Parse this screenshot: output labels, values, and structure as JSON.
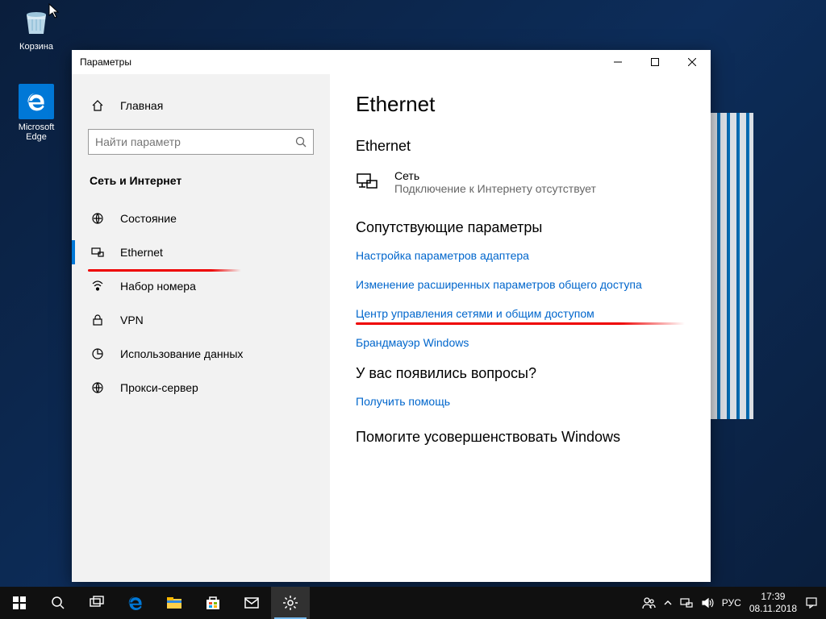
{
  "desktop": {
    "icons": {
      "recycle": "Корзина",
      "edge": "Microsoft Edge"
    }
  },
  "window": {
    "title": "Параметры"
  },
  "sidebar": {
    "home": "Главная",
    "search_placeholder": "Найти параметр",
    "section": "Сеть и Интернет",
    "items": [
      {
        "label": "Состояние"
      },
      {
        "label": "Ethernet"
      },
      {
        "label": "Набор номера"
      },
      {
        "label": "VPN"
      },
      {
        "label": "Использование данных"
      },
      {
        "label": "Прокси-сервер"
      }
    ]
  },
  "content": {
    "page_title": "Ethernet",
    "subheading": "Ethernet",
    "network": {
      "name": "Сеть",
      "status": "Подключение к Интернету отсутствует"
    },
    "related_heading": "Сопутствующие параметры",
    "links": [
      "Настройка параметров адаптера",
      "Изменение расширенных параметров общего доступа",
      "Центр управления сетями и общим доступом",
      "Брандмауэр Windows"
    ],
    "help_heading": "У вас появились вопросы?",
    "help_link": "Получить помощь",
    "improve_heading": "Помогите усовершенствовать Windows"
  },
  "taskbar": {
    "lang": "РУС",
    "time": "17:39",
    "date": "08.11.2018"
  }
}
